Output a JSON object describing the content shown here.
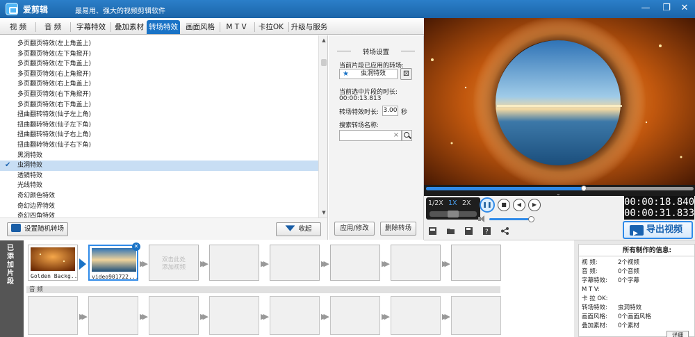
{
  "window": {
    "app_name": "爱剪辑",
    "slogan": "最易用、强大的视频剪辑软件",
    "minimize_glyph": "—",
    "restore_glyph": "❐",
    "close_glyph": "✕"
  },
  "tabs": [
    {
      "label": "视  频"
    },
    {
      "label": "音  频"
    },
    {
      "label": "字幕特效"
    },
    {
      "label": "叠加素材"
    },
    {
      "label": "转场特效",
      "active": true
    },
    {
      "label": "画面风格"
    },
    {
      "label": "M T V"
    },
    {
      "label": "卡拉OK"
    },
    {
      "label": "升级与服务"
    }
  ],
  "transitions": {
    "items": [
      "多页翻页特效(左上角盖上)",
      "多页翻页特效(左下角掀开)",
      "多页翻页特效(左下角盖上)",
      "多页翻页特效(右上角掀开)",
      "多页翻页特效(右上角盖上)",
      "多页翻页特效(右下角掀开)",
      "多页翻页特效(右下角盖上)",
      "扭曲翻转特效(仙子左上角)",
      "扭曲翻转特效(仙子左下角)",
      "扭曲翻转特效(仙子右上角)",
      "扭曲翻转特效(仙子右下角)",
      "黑洞特效",
      "虫洞特效",
      "透镜特效",
      "光线特效",
      "奇幻颜色特效",
      "奇幻边界特效",
      "奇幻四角特效"
    ],
    "selected_index": 12,
    "check_glyph": "✔"
  },
  "buttons": {
    "random": "设置随机转场",
    "collapse": "收起",
    "apply": "应用/修改",
    "delete": "删除转场"
  },
  "settings": {
    "header": "转场设置",
    "applied_label": "当前片段已应用的转场:",
    "applied_value": "虫洞特效",
    "applied_star": "★",
    "dice_glyph": "⚄",
    "clip_duration_label": "当前选中片段的时长:",
    "clip_duration_value": "00:00:13.813",
    "effect_duration_label": "转场特效时长:",
    "effect_duration_value": "3.00",
    "effect_duration_unit": "秒",
    "search_label": "搜索转场名称:",
    "search_value": "",
    "search_clear": "×"
  },
  "player": {
    "progress": 0.59,
    "speeds": [
      "1/2X",
      "1X",
      "2X"
    ],
    "active_speed": "1X",
    "time_current": "00:00:18.840",
    "time_total": "00:00:31.833",
    "volume": 0.8,
    "chevron": "⌄",
    "play_glyph": "❚❚",
    "stop_glyph": "■",
    "prev_glyph": "◀",
    "next_glyph": "▶"
  },
  "export": {
    "label": "导出视频"
  },
  "storyboard": {
    "track_label": "已添加片段",
    "clips": [
      {
        "caption": "Golden Backg..."
      },
      {
        "caption": "video901722..."
      }
    ],
    "add_hint": "双击此处\n添加视频",
    "remove_glyph": "✕",
    "audio_label": "音 频",
    "arrow_glyph": "▶▶"
  },
  "info": {
    "title": "所有制作的信息:",
    "rows": [
      {
        "k": "视    频:",
        "v": "2个视频"
      },
      {
        "k": "音    频:",
        "v": "0个音频"
      },
      {
        "k": "字幕特效:",
        "v": "0个字幕"
      },
      {
        "k": "M  T  V:",
        "v": ""
      },
      {
        "k": "卡 拉 OK:",
        "v": ""
      },
      {
        "k": "转场特效:",
        "v": "虫洞特效"
      },
      {
        "k": "画面风格:",
        "v": "0个画面风格"
      },
      {
        "k": "叠加素材:",
        "v": "0个素材"
      }
    ],
    "detail_button": "详细"
  }
}
